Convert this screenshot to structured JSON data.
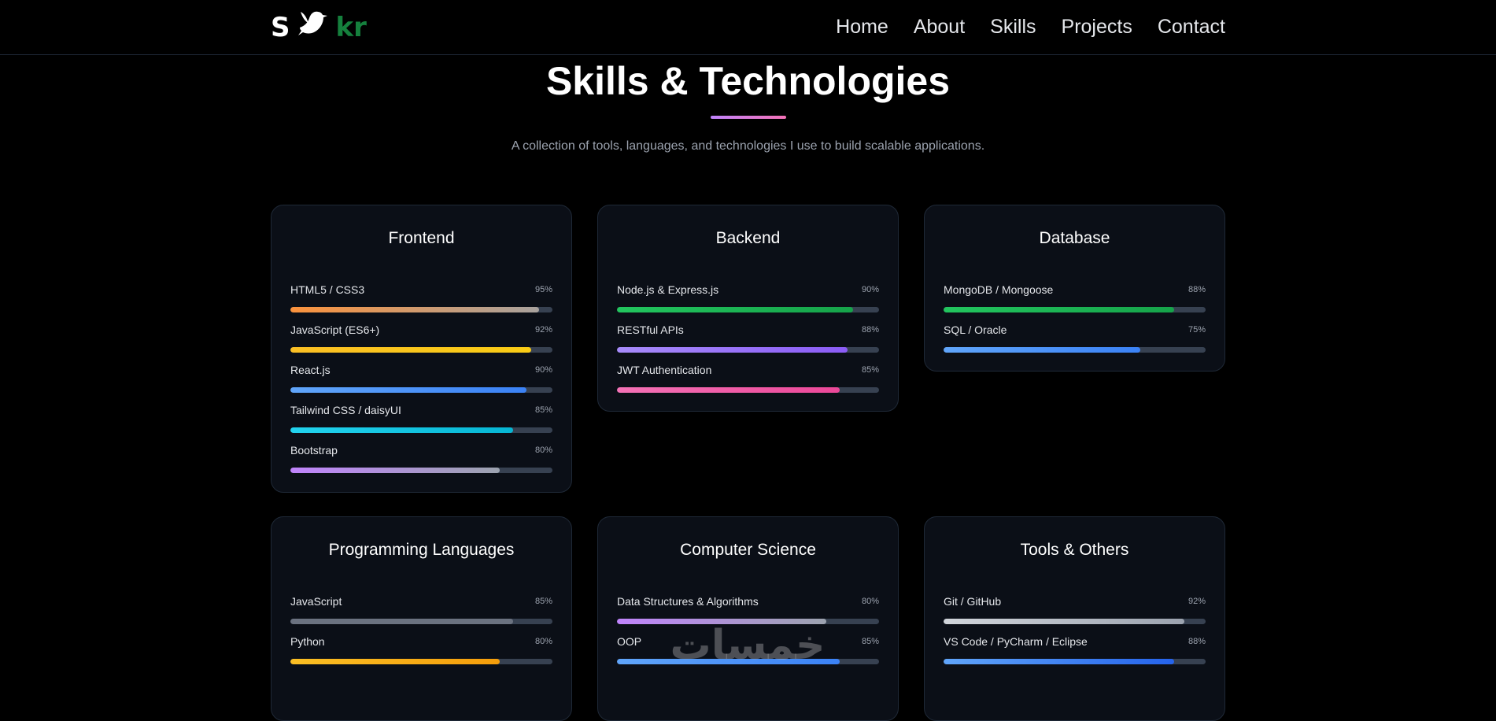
{
  "nav": {
    "logo_left": "S",
    "logo_right": "kr",
    "links": [
      "Home",
      "About",
      "Skills",
      "Projects",
      "Contact"
    ]
  },
  "section": {
    "title": "Skills & Technologies",
    "subtitle": "A collection of tools, languages, and technologies I use to build scalable applications."
  },
  "cards": [
    {
      "title": "Frontend",
      "skills": [
        {
          "name": "HTML5 / CSS3",
          "pct": "95%",
          "value": 0.95,
          "from": "#fb923c",
          "to": "#a8a29e"
        },
        {
          "name": "JavaScript (ES6+)",
          "pct": "92%",
          "value": 0.92,
          "from": "#fbbf24",
          "to": "#facc15"
        },
        {
          "name": "React.js",
          "pct": "90%",
          "value": 0.9,
          "from": "#60a5fa",
          "to": "#3b82f6"
        },
        {
          "name": "Tailwind CSS / daisyUI",
          "pct": "85%",
          "value": 0.85,
          "from": "#22d3ee",
          "to": "#06b6d4"
        },
        {
          "name": "Bootstrap",
          "pct": "80%",
          "value": 0.8,
          "from": "#c084fc",
          "to": "#9ca3af"
        }
      ]
    },
    {
      "title": "Backend",
      "skills": [
        {
          "name": "Node.js & Express.js",
          "pct": "90%",
          "value": 0.9,
          "from": "#22c55e",
          "to": "#16a34a"
        },
        {
          "name": "RESTful APIs",
          "pct": "88%",
          "value": 0.88,
          "from": "#a78bfa",
          "to": "#8b5cf6"
        },
        {
          "name": "JWT Authentication",
          "pct": "85%",
          "value": 0.85,
          "from": "#f472b6",
          "to": "#ec4899"
        }
      ]
    },
    {
      "title": "Database",
      "skills": [
        {
          "name": "MongoDB / Mongoose",
          "pct": "88%",
          "value": 0.88,
          "from": "#22c55e",
          "to": "#16a34a"
        },
        {
          "name": "SQL / Oracle",
          "pct": "75%",
          "value": 0.75,
          "from": "#60a5fa",
          "to": "#3b82f6"
        }
      ]
    },
    {
      "title": "Programming Languages",
      "skills": [
        {
          "name": "JavaScript",
          "pct": "85%",
          "value": 0.85,
          "from": "#6b7280",
          "to": "#6b7280"
        },
        {
          "name": "Python",
          "pct": "80%",
          "value": 0.8,
          "from": "#fbbf24",
          "to": "#f59e0b"
        }
      ]
    },
    {
      "title": "Computer Science",
      "skills": [
        {
          "name": "Data Structures & Algorithms",
          "pct": "80%",
          "value": 0.8,
          "from": "#c084fc",
          "to": "#9ca3af"
        },
        {
          "name": "OOP",
          "pct": "85%",
          "value": 0.85,
          "from": "#60a5fa",
          "to": "#3b82f6"
        }
      ]
    },
    {
      "title": "Tools & Others",
      "skills": [
        {
          "name": "Git / GitHub",
          "pct": "92%",
          "value": 0.92,
          "from": "#d1d5db",
          "to": "#9ca3af"
        },
        {
          "name": "VS Code / PyCharm / Eclipse",
          "pct": "88%",
          "value": 0.88,
          "from": "#60a5fa",
          "to": "#2563eb"
        }
      ]
    }
  ],
  "watermark": "خمسات"
}
